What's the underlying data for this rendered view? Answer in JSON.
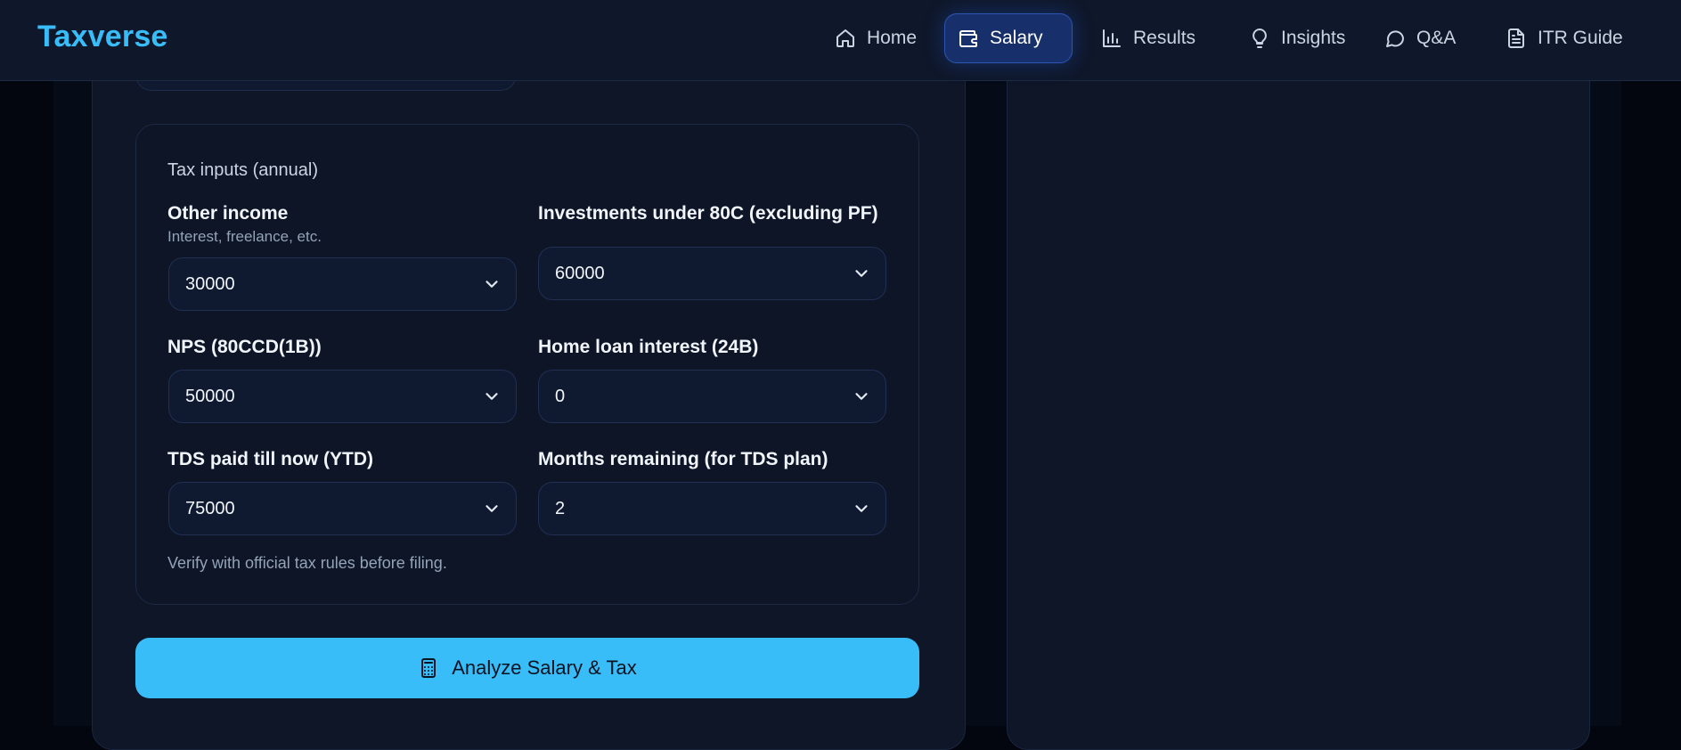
{
  "brand": "Taxverse",
  "nav": {
    "items": [
      {
        "label": "Home",
        "icon": "home-icon",
        "active": false
      },
      {
        "label": "Salary",
        "icon": "wallet-icon",
        "active": true
      },
      {
        "label": "Results",
        "icon": "bar-chart-icon",
        "active": false
      },
      {
        "label": "Insights",
        "icon": "lightbulb-icon",
        "active": false
      },
      {
        "label": "Q&A",
        "icon": "chat-bubble-icon",
        "active": false
      },
      {
        "label": "ITR Guide",
        "icon": "document-icon",
        "active": false
      }
    ]
  },
  "tax_inputs": {
    "title": "Tax inputs (annual)",
    "other_income": {
      "label": "Other income",
      "hint": "Interest, freelance, etc.",
      "value": "30000"
    },
    "investments_80c": {
      "label": "Investments under 80C (excluding PF)",
      "value": "60000"
    },
    "nps": {
      "label": "NPS (80CCD(1B))",
      "value": "50000"
    },
    "home_loan": {
      "label": "Home loan interest (24B)",
      "value": "0"
    },
    "tds_paid": {
      "label": "TDS paid till now (YTD)",
      "value": "75000"
    },
    "months_remaining": {
      "label": "Months remaining (for TDS plan)",
      "value": "2"
    },
    "note": "Verify with official tax rules before filing."
  },
  "analyze_button": {
    "label": "Analyze Salary & Tax",
    "icon": "calculator-icon"
  },
  "colors": {
    "accent": "#38bdf8",
    "active_nav_bg": "#17306b",
    "background": "#03060f",
    "card": "#0e1628"
  }
}
